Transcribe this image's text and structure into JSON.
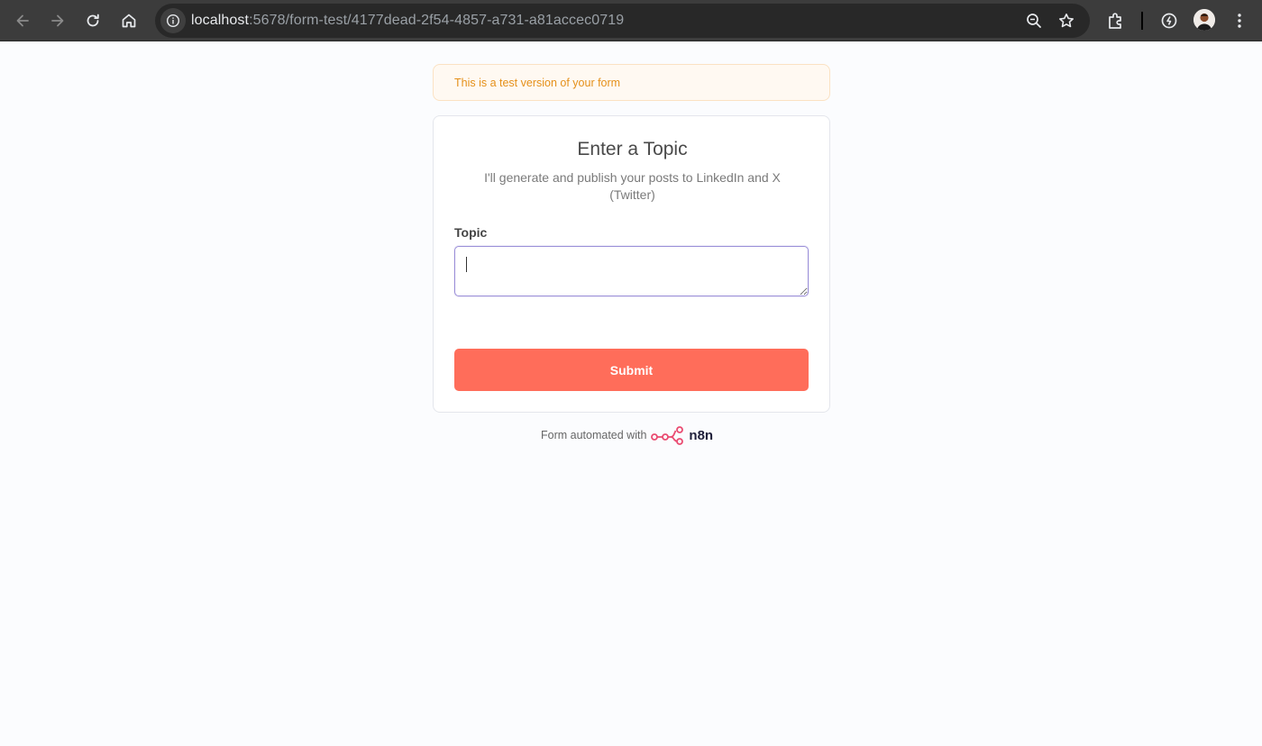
{
  "browser": {
    "url_host": "localhost",
    "url_path": ":5678/form-test/4177dead-2f54-4857-a731-a81accec0719",
    "icons": [
      "back-icon",
      "forward-icon",
      "reload-icon",
      "home-icon",
      "site-info-icon",
      "zoom-icon",
      "bookmark-star-icon",
      "extensions-icon",
      "performance-icon",
      "profile-avatar",
      "menu-icon"
    ]
  },
  "banner": {
    "text": "This is a test version of your form",
    "color": "#e5901a"
  },
  "form": {
    "title": "Enter a Topic",
    "description": "I'll generate and publish your posts to LinkedIn and X (Twitter)",
    "field_label": "Topic",
    "field_value": "",
    "submit_label": "Submit",
    "accent": "#ff6d5a"
  },
  "footer": {
    "text": "Form automated with",
    "brand": "n8n",
    "brand_color": "#ea4b71"
  }
}
